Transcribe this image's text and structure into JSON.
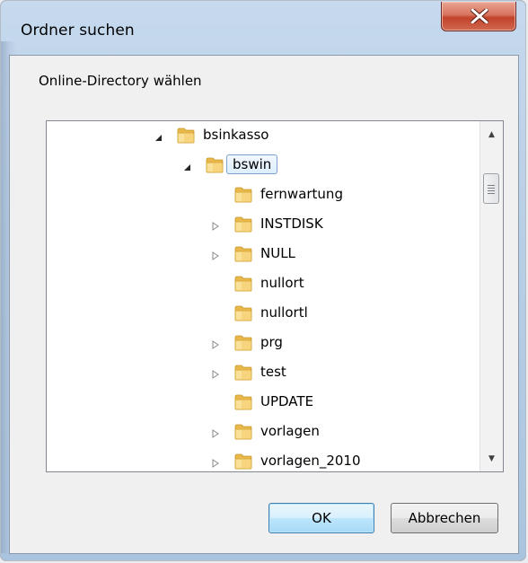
{
  "window": {
    "title": "Ordner suchen",
    "close_icon": "close-icon"
  },
  "dialog": {
    "prompt": "Online-Directory wählen"
  },
  "tree": {
    "nodes": [
      {
        "label": "bsinkasso",
        "expander": "expanded",
        "depth": 0,
        "selected": false
      },
      {
        "label": "bswin",
        "expander": "expanded",
        "depth": 1,
        "selected": true
      },
      {
        "label": "fernwartung",
        "expander": "none",
        "depth": 2,
        "selected": false
      },
      {
        "label": "INSTDISK",
        "expander": "collapsed",
        "depth": 2,
        "selected": false
      },
      {
        "label": "NULL",
        "expander": "collapsed",
        "depth": 2,
        "selected": false
      },
      {
        "label": "nullort",
        "expander": "none",
        "depth": 2,
        "selected": false
      },
      {
        "label": "nullortl",
        "expander": "none",
        "depth": 2,
        "selected": false
      },
      {
        "label": "prg",
        "expander": "collapsed",
        "depth": 2,
        "selected": false
      },
      {
        "label": "test",
        "expander": "collapsed",
        "depth": 2,
        "selected": false
      },
      {
        "label": "UPDATE",
        "expander": "none",
        "depth": 2,
        "selected": false
      },
      {
        "label": "vorlagen",
        "expander": "collapsed",
        "depth": 2,
        "selected": false
      },
      {
        "label": "vorlagen_2010",
        "expander": "collapsed",
        "depth": 2,
        "selected": false
      }
    ]
  },
  "buttons": {
    "ok": "OK",
    "cancel": "Abbrechen"
  },
  "colors": {
    "close_red": "#c1432a",
    "folder_yellow": "#f3d27a",
    "selection_border": "#7da2ce",
    "ok_border": "#3c7fb1"
  }
}
